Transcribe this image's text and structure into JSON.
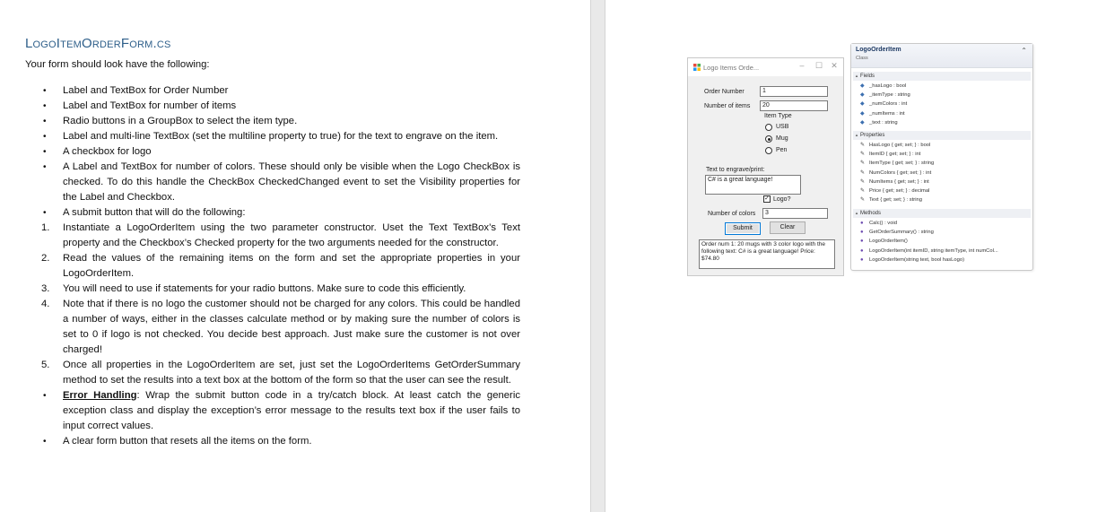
{
  "document": {
    "heading": "LogoItemOrderForm.cs",
    "intro": "Your form should look have the following:",
    "items": [
      {
        "marker": "•",
        "text": "Label and TextBox for Order Number"
      },
      {
        "marker": "•",
        "text": "Label and TextBox for number of items"
      },
      {
        "marker": "•",
        "text": "Radio buttons in a GroupBox to select the item type."
      },
      {
        "marker": "•",
        "text": "Label and multi-line TextBox (set the multiline property to true) for the text to engrave on the item."
      },
      {
        "marker": "•",
        "text": "A checkbox for logo"
      },
      {
        "marker": "•",
        "text": "A Label and TextBox for number of colors. These should only be visible when the Logo CheckBox is checked. To do this handle the CheckBox CheckedChanged event to set the Visibility properties for the Label and Checkbox."
      },
      {
        "marker": "•",
        "text": "A submit button that will do the following:"
      },
      {
        "marker": "1.",
        "text": "Instantiate a LogoOrderItem using the two parameter constructor. Uset the Text TextBox’s Text property and the Checkbox’s Checked property for the two arguments needed for the constructor."
      },
      {
        "marker": "2.",
        "text": "Read the values of the remaining items on the form and set the appropriate properties in your LogoOrderItem."
      },
      {
        "marker": "3.",
        "text": "You will need to use if statements for your radio buttons. Make sure to code this efficiently."
      },
      {
        "marker": "4.",
        "text": "Note that if there is no logo the customer should not be charged for any colors. This could be handled a number of ways, either in the classes calculate method or by making sure the number of colors is set to 0 if logo is not checked. You decide best approach. Just make sure the customer is not over charged!"
      },
      {
        "marker": "5.",
        "text": "Once all properties in the LogoOrderItem are set, just set the LogoOrderItems GetOrderSummary method to set the results into a text box at the bottom of the form so that the user can see the result."
      },
      {
        "marker": "•",
        "label": "Error Handling",
        "text": ": Wrap the submit button code in a try/catch block. At least catch the generic exception class and display the exception’s error message to the results text box if the user fails to input correct values."
      },
      {
        "marker": "•",
        "text": "A clear form button that resets all the items on the form."
      }
    ]
  },
  "form_window": {
    "title": "Logo Items Orde...",
    "order_number_label": "Order Number",
    "order_number_value": "1",
    "number_items_label": "Number of items",
    "number_items_value": "20",
    "group_label": "Item Type",
    "radio_options": [
      "USB",
      "Mug",
      "Pen"
    ],
    "selected_option": "Mug",
    "engrave_label": "Text to engrave/print:",
    "engrave_value": "C# is a great language!",
    "logo_label": "Logo?",
    "logo_checked": true,
    "colors_label": "Number of colors",
    "colors_value": "3",
    "submit_label": "Submit",
    "clear_label": "Clear",
    "result_text": "Order num 1: 20 mugs with 3 color logo with the following text: C# is a great language! Price: $74.80"
  },
  "class_diagram": {
    "name": "LogoOrderItem",
    "kind": "Class",
    "fields_header": "Fields",
    "fields": [
      "_hasLogo : bool",
      "_itemType : string",
      "_numColors : int",
      "_numItems : int",
      "_text : string"
    ],
    "properties_header": "Properties",
    "properties": [
      "HasLogo { get; set; } : bool",
      "ItemID { get; set; } : int",
      "ItemType { get; set; } : string",
      "NumColors { get; set; } : int",
      "NumItems { get; set; } : int",
      "Price { get; set; } : decimal",
      "Text { get; set; } : string"
    ],
    "methods_header": "Methods",
    "methods": [
      "Calc() : void",
      "GetOrderSummary() : string",
      "LogoOrderItem()",
      "LogoOrderItem(int itemID, string itemType, int numCol...",
      "LogoOrderItem(string text, bool hasLogo)"
    ]
  },
  "colors": {
    "heading": "#2e5f8a",
    "button_focus": "#0078d7",
    "class_title": "#1e3a64"
  }
}
